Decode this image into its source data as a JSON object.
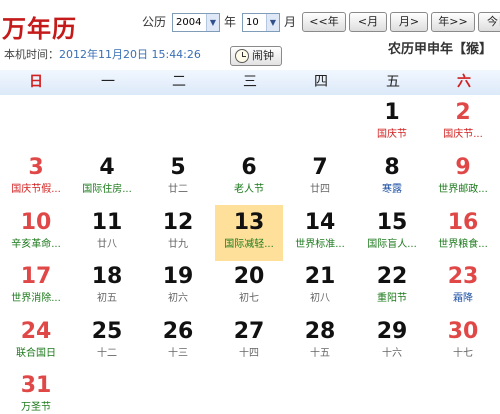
{
  "header": {
    "title": "万年历",
    "local_time_label": "本机时间：",
    "local_time_value": "2012年11月20日 15:44:26",
    "alarm_label": "闹钟",
    "lunar_year": "农历甲申年【猴】"
  },
  "controls": {
    "gongli_label": "公历",
    "year_value": "2004",
    "year_unit": "年",
    "month_value": "10",
    "month_unit": "月",
    "prev_year": "<<年",
    "prev_month": "<月",
    "next_month": "月>",
    "next_year": "年>>",
    "today": "今日"
  },
  "weekdays": [
    "日",
    "一",
    "二",
    "三",
    "四",
    "五",
    "六"
  ],
  "colors": {
    "weekend": "#d21f1f",
    "today_highlight": "#ffe09a",
    "festival_red": "#d21f1f",
    "festival_green": "#1c7a1c",
    "solar_term_blue": "#1b4fa3"
  },
  "weeks": [
    [
      null,
      null,
      null,
      null,
      null,
      {
        "day": "1",
        "sub": "国庆节",
        "tone": "red"
      },
      {
        "day": "2",
        "sub": "国庆节...",
        "tone": "red"
      }
    ],
    [
      {
        "day": "3",
        "sub": "国庆节假...",
        "tone": "red"
      },
      {
        "day": "4",
        "sub": "国际住房...",
        "tone": "green"
      },
      {
        "day": "5",
        "sub": "廿二",
        "tone": "gray"
      },
      {
        "day": "6",
        "sub": "老人节",
        "tone": "green"
      },
      {
        "day": "7",
        "sub": "廿四",
        "tone": "gray"
      },
      {
        "day": "8",
        "sub": "寒露",
        "tone": "blue"
      },
      {
        "day": "9",
        "sub": "世界邮政...",
        "tone": "green"
      }
    ],
    [
      {
        "day": "10",
        "sub": "辛亥革命...",
        "tone": "green"
      },
      {
        "day": "11",
        "sub": "廿八",
        "tone": "gray"
      },
      {
        "day": "12",
        "sub": "廿九",
        "tone": "gray"
      },
      {
        "day": "13",
        "sub": "国际减轻...",
        "tone": "green",
        "today": true
      },
      {
        "day": "14",
        "sub": "世界标准...",
        "tone": "green"
      },
      {
        "day": "15",
        "sub": "国际盲人...",
        "tone": "green"
      },
      {
        "day": "16",
        "sub": "世界粮食...",
        "tone": "green"
      }
    ],
    [
      {
        "day": "17",
        "sub": "世界消除...",
        "tone": "green"
      },
      {
        "day": "18",
        "sub": "初五",
        "tone": "gray"
      },
      {
        "day": "19",
        "sub": "初六",
        "tone": "gray"
      },
      {
        "day": "20",
        "sub": "初七",
        "tone": "gray"
      },
      {
        "day": "21",
        "sub": "初八",
        "tone": "gray"
      },
      {
        "day": "22",
        "sub": "重阳节",
        "tone": "green"
      },
      {
        "day": "23",
        "sub": "霜降",
        "tone": "blue"
      }
    ],
    [
      {
        "day": "24",
        "sub": "联合国日",
        "tone": "green"
      },
      {
        "day": "25",
        "sub": "十二",
        "tone": "gray"
      },
      {
        "day": "26",
        "sub": "十三",
        "tone": "gray"
      },
      {
        "day": "27",
        "sub": "十四",
        "tone": "gray"
      },
      {
        "day": "28",
        "sub": "十五",
        "tone": "gray"
      },
      {
        "day": "29",
        "sub": "十六",
        "tone": "gray"
      },
      {
        "day": "30",
        "sub": "十七",
        "tone": "gray"
      }
    ],
    [
      {
        "day": "31",
        "sub": "万圣节",
        "tone": "green"
      },
      null,
      null,
      null,
      null,
      null,
      null
    ]
  ]
}
